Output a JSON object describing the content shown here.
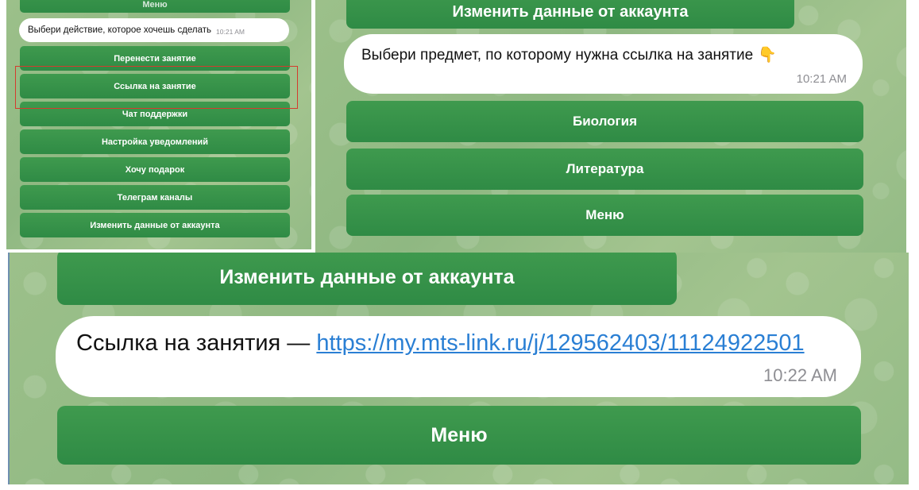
{
  "panel1": {
    "top_button_partial": "Меню",
    "message": {
      "text": "Выбери действие, которое хочешь сделать",
      "time": "10:21 AM"
    },
    "buttons": [
      "Перенести занятие",
      "Ссылка на занятие",
      "Чат поддержки",
      "Настройка уведомлений",
      "Хочу подарок",
      "Телеграм каналы",
      "Изменить данные от аккаунта"
    ],
    "highlight_color": "#d43b2e"
  },
  "panel2": {
    "top_button": "Изменить данные от аккаунта",
    "message": {
      "text": "Выбери предмет, по которому нужна ссылка на занятие",
      "emoji": "👇",
      "time": "10:21 AM"
    },
    "buttons": [
      "Биология",
      "Литература",
      "Меню"
    ]
  },
  "panel3": {
    "top_button": "Изменить данные от аккаунта",
    "message": {
      "prefix": "Ссылка на занятия — ",
      "link": "https://my.mts-link.ru/j/129562403/11124922501",
      "time": "10:22 AM"
    },
    "bottom_button": "Меню"
  },
  "colors": {
    "button": "#2f8b45",
    "link": "#2a7fd4",
    "bubble": "#ffffff"
  }
}
